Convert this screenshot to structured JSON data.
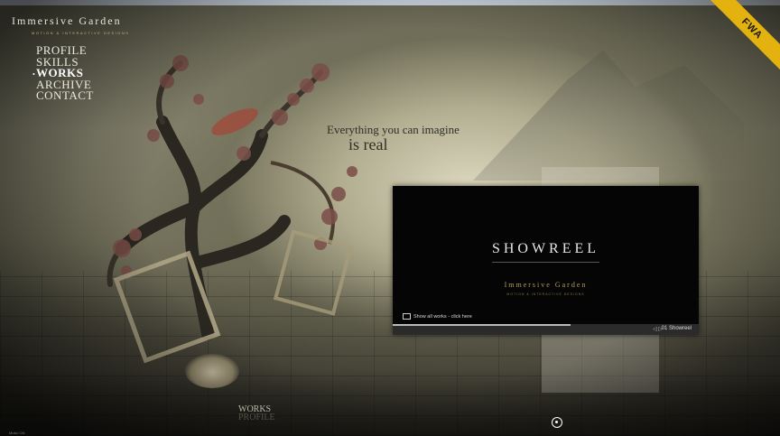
{
  "browser": {
    "topbar_color": "#cfd9e4"
  },
  "brand": {
    "name": "Immersive Garden",
    "subtitle": "MOTION & INTERACTIVE DESIGNS"
  },
  "nav": {
    "items": [
      {
        "label": "PROFILE",
        "active": false
      },
      {
        "label": "SKILLS",
        "active": false
      },
      {
        "label": "WORKS",
        "active": true
      },
      {
        "label": "ARCHIVE",
        "active": false
      },
      {
        "label": "CONTACT",
        "active": false
      }
    ]
  },
  "tagline": {
    "line1": "Everything you can imagine",
    "line2": "is real"
  },
  "badge": {
    "label": "FWA",
    "color": "#e3b20f"
  },
  "showreel": {
    "title": "SHOWREEL",
    "brand": "Immersive Garden",
    "brand_sub": "MOTION & INTERACTIVE DESIGNS",
    "show_all": "Show all works - click here",
    "counter_arrows": "◁ ▷",
    "current_label": "01  Showreel",
    "progress_percent": 58
  },
  "footer": {
    "section_label": "WORKS",
    "section_ghost": "PROFILE",
    "music": "Music ON"
  }
}
